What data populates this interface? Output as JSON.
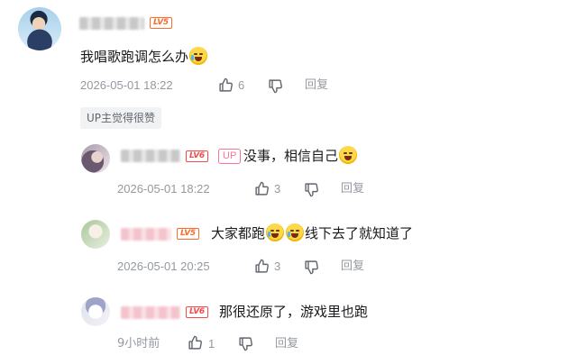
{
  "main_comment": {
    "level": "LV5",
    "text": "我唱歌跑调怎么办",
    "timestamp": "2026-05-01 18:22",
    "like_count": "6",
    "reply_label": "回复",
    "tag": "UP主觉得很赞"
  },
  "replies": [
    {
      "level": "LV6",
      "up_badge": "UP",
      "text": "没事，相信自己",
      "timestamp": "2026-05-01 18:22",
      "like_count": "3",
      "reply_label": "回复"
    },
    {
      "level": "LV5",
      "text_part1": "大家都跑",
      "text_part2": "线下去了就知道了",
      "timestamp": "2026-05-01 20:25",
      "like_count": "3",
      "reply_label": "回复"
    },
    {
      "level": "LV6",
      "text": "那很还原了，游戏里也跑",
      "timestamp": "9小时前",
      "like_count": "1",
      "reply_label": "回复"
    }
  ],
  "icons": {
    "like": "thumbs-up-icon",
    "dislike": "thumbs-down-icon",
    "emoji": "crying-laugh-emoji-icon"
  },
  "colors": {
    "level5": "#ff6a2b",
    "level6": "#f44a4a",
    "up_badge": "#fb7299",
    "meta_text": "#9499a0",
    "tag_bg": "#f1f2f3"
  }
}
